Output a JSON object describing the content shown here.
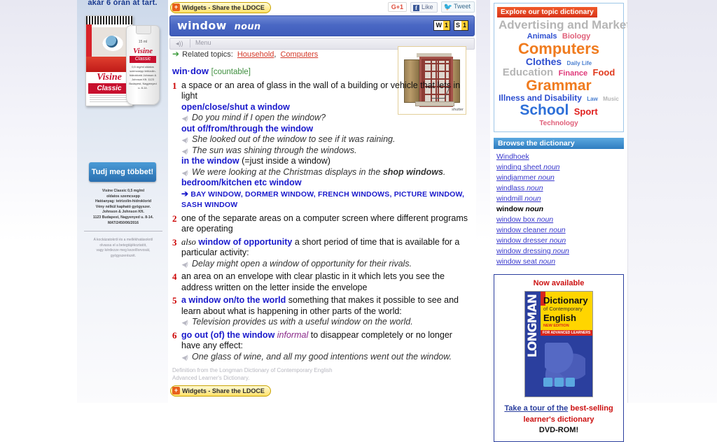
{
  "left_ad": {
    "top_text": "akár 6 órán át tart.",
    "brand": "Visine",
    "sub_brand": "Classic",
    "bottle_volume": "15 ml",
    "bottle_desc": "0,5 mg/ml oldatos szemcsepp tetrizolin-hidroklorid Johnson & Johnson Kft. 1123 Budapest, Nagyenyed u. 8-14.",
    "cta_label": "Tudj meg többet!",
    "legal_lines": [
      "Visine Classic 0,5 mg/ml",
      "oldatos szemcsepp",
      "Hatóanyag: tetrizolin-hidroklorid",
      "Vény nélkül kapható gyógyszer.",
      "Johnson & Johnson Kft.",
      "1123 Budapest, Nagyenyed u. 8-14.",
      "MAT/2450/06/2016"
    ],
    "disclaimer_lines": [
      "A kockázatokról és a mellékhatásokról",
      "olvassa el a betegtájékoztatót,",
      "vagy kérdezze meg kezelőorvosát,",
      "gyógyszerészét."
    ]
  },
  "toolbar": {
    "widgets_label": "Widgets - Share the LDOCE",
    "widgets_plus": "+",
    "gplus_label": "G+1",
    "facebook_icon_letter": "f",
    "facebook_label": "Like",
    "twitter_icon": "🐦",
    "twitter_label": "Tweet"
  },
  "entry_header": {
    "headword": "window",
    "part_of_speech": "noun",
    "badges": [
      {
        "letter": "W",
        "rank": "1"
      },
      {
        "letter": "S",
        "rank": "1"
      }
    ],
    "menu_label": "Menu",
    "speaker_icon": "◂))"
  },
  "related_topics": {
    "arrow": "➔",
    "label": "Related topics:",
    "links": [
      "Household",
      "Computers"
    ],
    "separator": ","
  },
  "illustration": {
    "caption": "shutter",
    "alt_name": "window-with-shutters"
  },
  "entry": {
    "hyphenated_headword": "win·dow",
    "grammar_code": "[countable]",
    "senses": [
      {
        "num": "1",
        "definition": "a space or an area of glass in the wall of a building or vehicle that lets in light",
        "blocks": [
          {
            "type": "collocation",
            "text": "open/close/shut a window"
          },
          {
            "type": "example",
            "text": "Do you mind if I open the window?"
          },
          {
            "type": "collocation",
            "text": "out of/from/through the window"
          },
          {
            "type": "example",
            "text": "She looked out of the window to see if it was raining."
          },
          {
            "type": "example",
            "text": "The sun was shining through the windows."
          },
          {
            "type": "collocation",
            "text": "in the window",
            "gloss": "(=just inside a window)"
          },
          {
            "type": "example_mixed",
            "pre": "We were looking at the Christmas displays in the ",
            "bold": "shop windows",
            "post": "."
          },
          {
            "type": "collocation",
            "text": "bedroom/kitchen etc window"
          }
        ],
        "crossrefs": "BAY WINDOW, DORMER WINDOW, FRENCH WINDOWS, PICTURE WINDOW, SASH WINDOW",
        "crossref_arrow": "➔"
      },
      {
        "num": "2",
        "definition": "one of the separate areas on a computer screen where different programs are operating",
        "blocks": []
      },
      {
        "num": "3",
        "also_label": "also",
        "lexical_unit": "window of opportunity",
        "definition": "a short period of time that is available for a particular activity:",
        "blocks": [
          {
            "type": "example",
            "text": "Delay might open a window of opportunity for their rivals."
          }
        ]
      },
      {
        "num": "4",
        "definition": "an area on an envelope with clear plastic in it which lets you see the address written on the letter inside the envelope",
        "blocks": []
      },
      {
        "num": "5",
        "lexical_unit": "a window on/to the world",
        "definition": "something that makes it possible to see and learn about what is happening in other parts of the world:",
        "blocks": [
          {
            "type": "example",
            "text": "Television provides us with a useful window on the world."
          }
        ]
      },
      {
        "num": "6",
        "lexical_unit": "go out (of) the window",
        "register": "informal",
        "definition": "to disappear completely or no longer have any effect:",
        "blocks": [
          {
            "type": "example",
            "text": "One glass of wine, and all my good intentions went out the window."
          }
        ]
      }
    ],
    "source_lines": [
      "Definition from the Longman Dictionary of Contemporary English",
      "Advanced Learner's Dictionary."
    ]
  },
  "topic_dictionary": {
    "header": "Explore our topic dictionary",
    "tags": [
      {
        "label": "Advertising and Marketing",
        "size": 17,
        "color": "#b5b5b5"
      },
      {
        "label": "Animals",
        "size": 11,
        "color": "#2d4fd0"
      },
      {
        "label": "Biology",
        "size": 11,
        "color": "#e0607a"
      },
      {
        "label": "Computers",
        "size": 22,
        "color": "#f07b1e"
      },
      {
        "label": "Clothes",
        "size": 14,
        "color": "#2d4fd0"
      },
      {
        "label": "Daily Life",
        "size": 8,
        "color": "#4a7fd0"
      },
      {
        "label": "Education",
        "size": 15,
        "color": "#b5b5b5"
      },
      {
        "label": "Finance",
        "size": 11,
        "color": "#e03a7a"
      },
      {
        "label": "Food",
        "size": 13,
        "color": "#e03a1e"
      },
      {
        "label": "Grammar",
        "size": 21,
        "color": "#f07b1e"
      },
      {
        "label": "Illness and Disability",
        "size": 12,
        "color": "#2d4fd0"
      },
      {
        "label": "Law",
        "size": 8,
        "color": "#4a7fd0"
      },
      {
        "label": "Music",
        "size": 8,
        "color": "#b5b5b5"
      },
      {
        "label": "School",
        "size": 21,
        "color": "#2d6fd8"
      },
      {
        "label": "Sport",
        "size": 13,
        "color": "#e0201e"
      },
      {
        "label": "Technology",
        "size": 10,
        "color": "#e0607a"
      }
    ]
  },
  "browse": {
    "header": "Browse the dictionary",
    "items": [
      {
        "word": "Windhoek",
        "pos": "",
        "current": false
      },
      {
        "word": "winding sheet",
        "pos": "noun",
        "current": false
      },
      {
        "word": "windjammer",
        "pos": "noun",
        "current": false
      },
      {
        "word": "windlass",
        "pos": "noun",
        "current": false
      },
      {
        "word": "windmill",
        "pos": "noun",
        "current": false
      },
      {
        "word": "window",
        "pos": "noun",
        "current": true
      },
      {
        "word": "window box",
        "pos": "noun",
        "current": false
      },
      {
        "word": "window cleaner",
        "pos": "noun",
        "current": false
      },
      {
        "word": "window dresser",
        "pos": "noun",
        "current": false
      },
      {
        "word": "window dressing",
        "pos": "noun",
        "current": false
      },
      {
        "word": "window seat",
        "pos": "noun",
        "current": false
      }
    ]
  },
  "promo": {
    "now_available": "Now available",
    "book": {
      "spine": "LONGMAN",
      "title_line1": "Dictionary",
      "title_line2": "of Contemporary",
      "title_line3": "English",
      "edition": "NEW EDITION",
      "audience": "FOR ADVANCED LEARNERS"
    },
    "cta_link": "Take a tour of the",
    "cta_red": "best-selling learner's dictionary",
    "cta_dvd": "DVD-ROM!"
  }
}
